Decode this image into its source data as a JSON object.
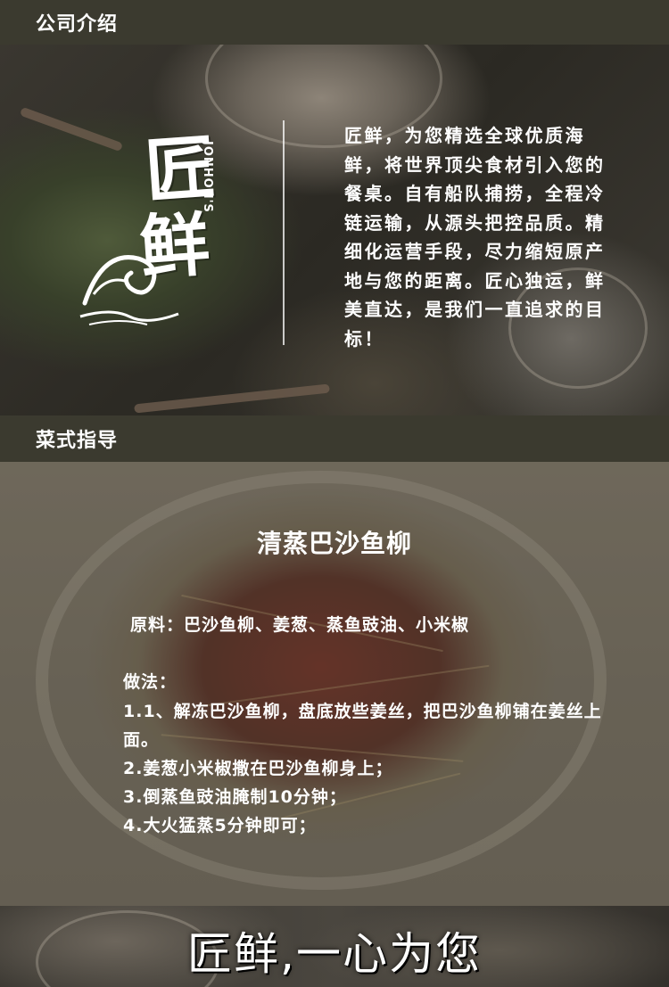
{
  "sections": {
    "company_intro_title": "公司介绍",
    "recipe_guide_title": "菜式指导"
  },
  "brand": {
    "logo_char_1": "匠",
    "logo_char_2": "鲜",
    "logo_en": "JONHON'S",
    "intro_text": "匠鲜，为您精选全球优质海鲜，将世界顶尖食材引入您的餐桌。自有船队捕捞，全程冷链运输，从源头把控品质。精细化运营手段，尽力缩短原产地与您的距离。匠心独运，鲜美直达，是我们一直追求的目标！"
  },
  "recipe": {
    "dish_title": "清蒸巴沙鱼柳",
    "ingredients": "原料：巴沙鱼柳、姜葱、蒸鱼豉油、小米椒",
    "method_title": "做法：",
    "steps": [
      "1.1、解冻巴沙鱼柳，盘底放些姜丝，把巴沙鱼柳铺在姜丝上面。",
      "2.姜葱小米椒撒在巴沙鱼柳身上；",
      "3.倒蒸鱼豉油腌制10分钟；",
      "4.大火猛蒸5分钟即可；"
    ]
  },
  "footer": {
    "slogan": "匠鲜,一心为您"
  },
  "colors": {
    "section_bar": "#3b3a2f",
    "text": "#ffffff"
  }
}
